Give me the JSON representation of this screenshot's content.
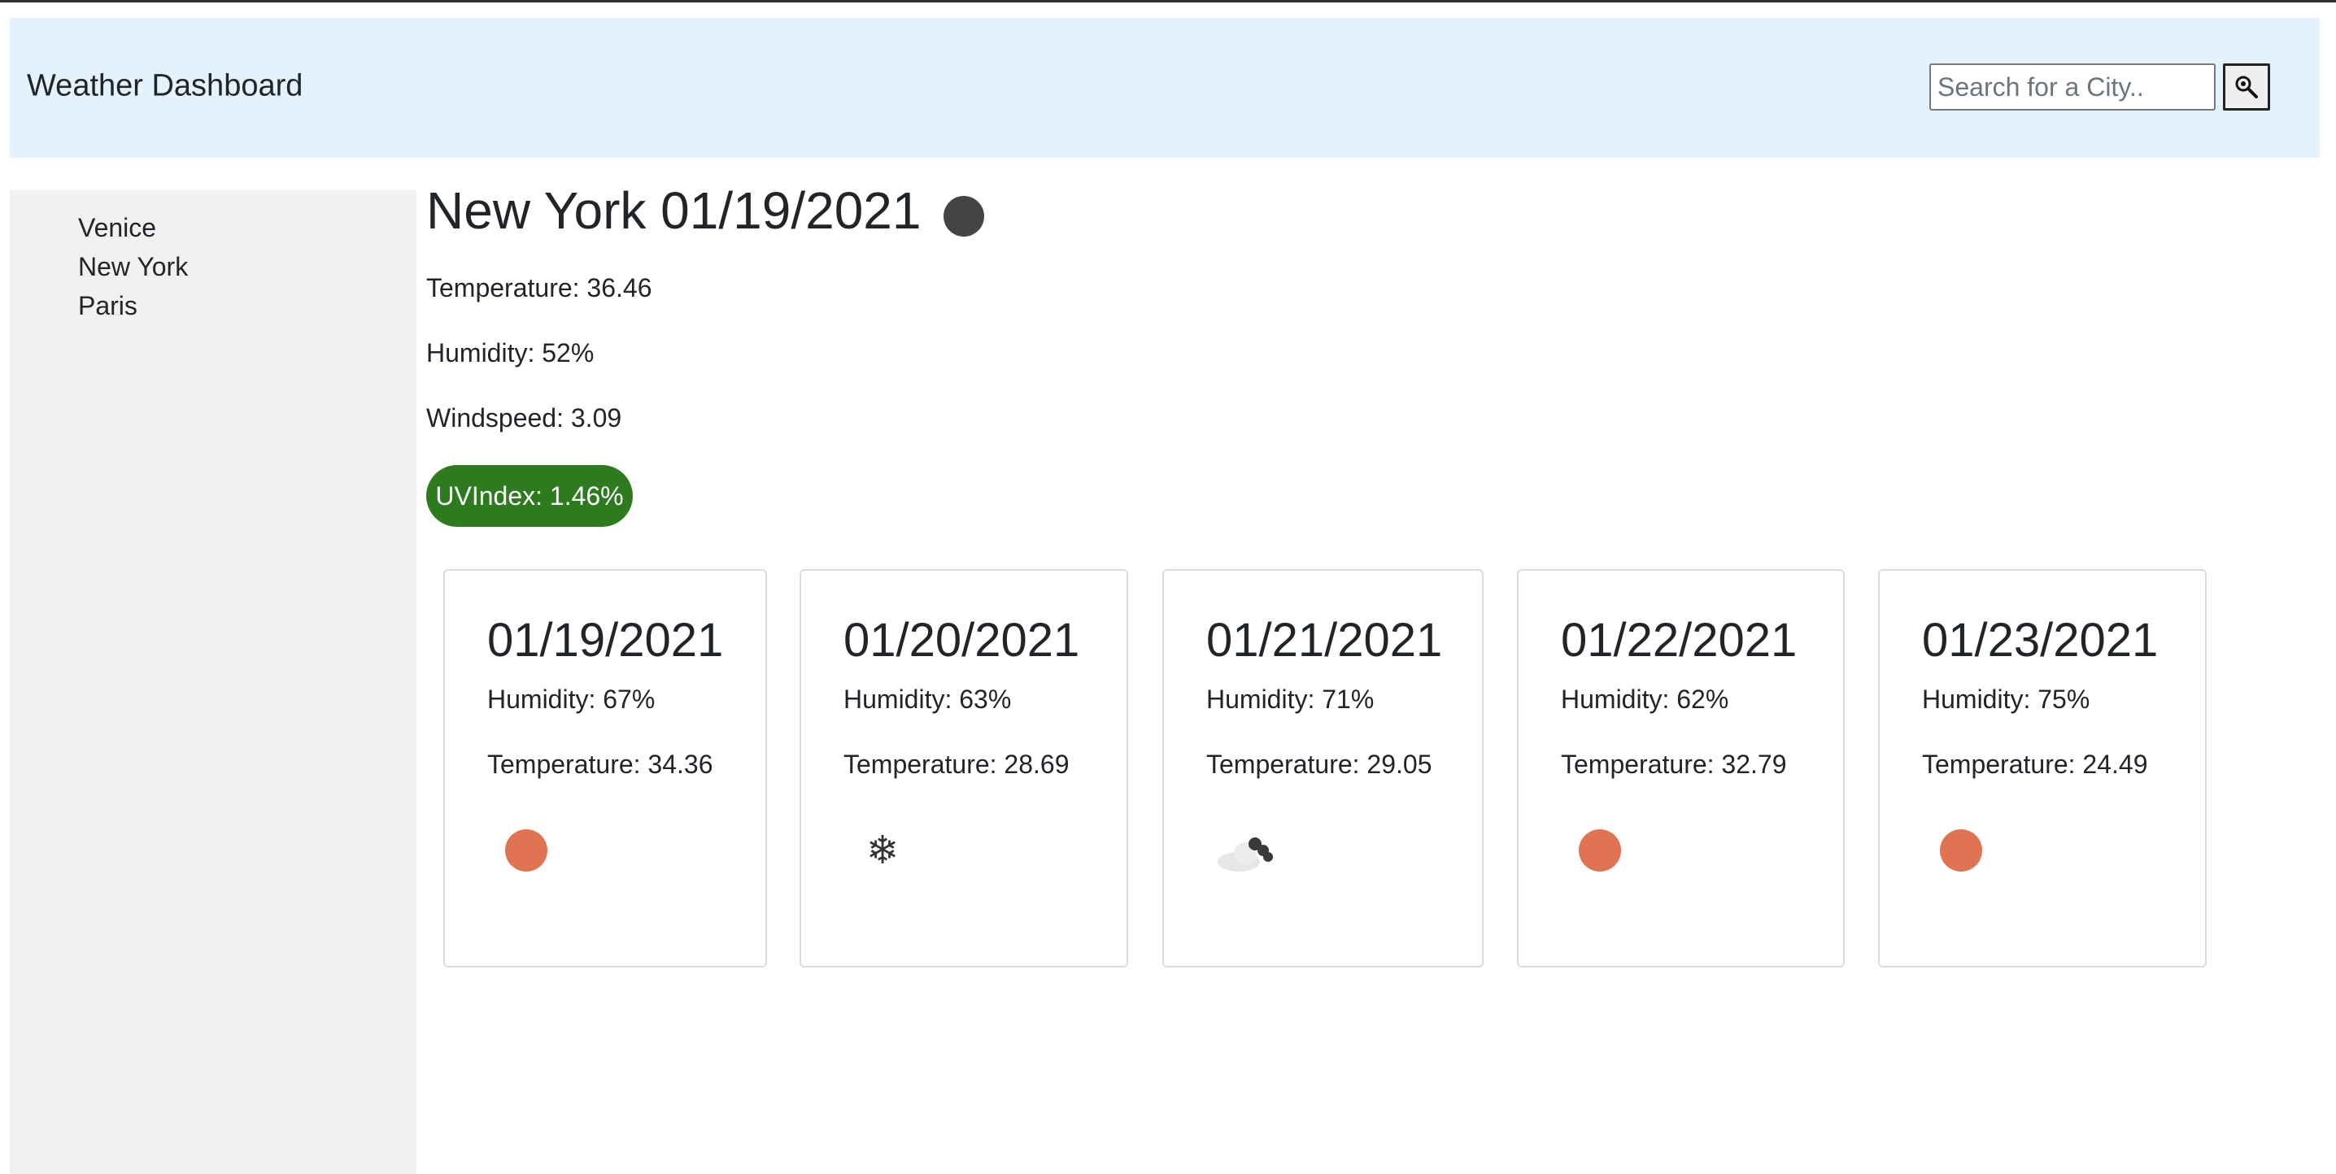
{
  "header": {
    "brand": "Weather Dashboard",
    "search_placeholder": "Search for a City..",
    "search_value": ""
  },
  "sidebar": {
    "cities": [
      {
        "label": "Venice"
      },
      {
        "label": "New York"
      },
      {
        "label": "Paris"
      }
    ]
  },
  "current": {
    "title": "New York 01/19/2021",
    "icon": "dark-circle-icon",
    "temperature": "Temperature: 36.46",
    "humidity": "Humidity: 52%",
    "windspeed": "Windspeed: 3.09",
    "uv_index": "UVIndex: 1.46%",
    "uv_color": "#2d7a1f"
  },
  "forecast": [
    {
      "date": "01/19/2021",
      "humidity": "Humidity: 67%",
      "temperature": "Temperature: 34.36",
      "icon": "sun-icon"
    },
    {
      "date": "01/20/2021",
      "humidity": "Humidity: 63%",
      "temperature": "Temperature: 28.69",
      "icon": "snowflake-icon"
    },
    {
      "date": "01/21/2021",
      "humidity": "Humidity: 71%",
      "temperature": "Temperature: 29.05",
      "icon": "cloud-icon"
    },
    {
      "date": "01/22/2021",
      "humidity": "Humidity: 62%",
      "temperature": "Temperature: 32.79",
      "icon": "sun-icon"
    },
    {
      "date": "01/23/2021",
      "humidity": "Humidity: 75%",
      "temperature": "Temperature: 24.49",
      "icon": "sun-icon"
    }
  ],
  "colors": {
    "navbar_bg": "#e3f2fd",
    "sidebar_bg": "#f1f1f1",
    "sun": "#e07352"
  }
}
